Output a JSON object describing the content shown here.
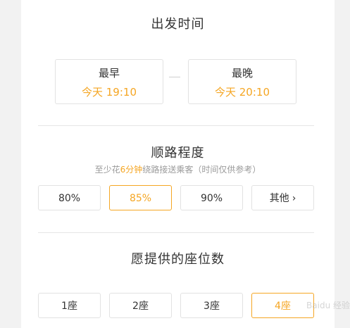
{
  "departure": {
    "title": "出发时间",
    "earliest": {
      "label": "最早",
      "value": "今天 19:10"
    },
    "latest": {
      "label": "最晚",
      "value": "今天 20:10"
    }
  },
  "detour": {
    "title": "顺路程度",
    "subtitle": {
      "prefix": "至少花",
      "highlight": "6分钟",
      "suffix": "绕路接送乘客（时间仅供参考）"
    },
    "options": [
      "80%",
      "85%",
      "90%",
      "其他"
    ],
    "selected_index": 1,
    "more_chevron": "›"
  },
  "seats": {
    "title": "愿提供的座位数",
    "options": [
      "1座",
      "2座",
      "3座",
      "4座"
    ],
    "selected_index": 3
  },
  "colors": {
    "accent": "#f5a623",
    "text": "#333333",
    "muted": "#9a9a9a"
  },
  "watermark": "Baidu 经验"
}
